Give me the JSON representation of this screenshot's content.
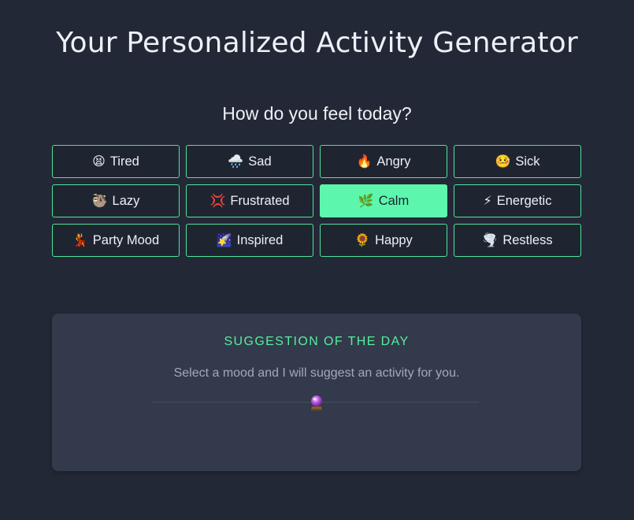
{
  "title": "Your Personalized Activity Generator",
  "question": "How do you feel today?",
  "moods": [
    {
      "emoji": "😫",
      "label": "Tired",
      "icon": "tired-face-icon",
      "selected": false
    },
    {
      "emoji": "🌧️",
      "label": "Sad",
      "icon": "rain-cloud-icon",
      "selected": false
    },
    {
      "emoji": "🔥",
      "label": "Angry",
      "icon": "fire-icon",
      "selected": false
    },
    {
      "emoji": "🤒",
      "label": "Sick",
      "icon": "sick-face-icon",
      "selected": false
    },
    {
      "emoji": "🦥",
      "label": "Lazy",
      "icon": "sloth-icon",
      "selected": false
    },
    {
      "emoji": "💢",
      "label": "Frustrated",
      "icon": "anger-symbol-icon",
      "selected": false
    },
    {
      "emoji": "🌿",
      "label": "Calm",
      "icon": "herb-icon",
      "selected": true
    },
    {
      "emoji": "⚡",
      "label": "Energetic",
      "icon": "lightning-icon",
      "selected": false
    },
    {
      "emoji": "💃",
      "label": "Party Mood",
      "icon": "dancer-icon",
      "selected": false
    },
    {
      "emoji": "🌠",
      "label": "Inspired",
      "icon": "shooting-star-icon",
      "selected": false
    },
    {
      "emoji": "🌻",
      "label": "Happy",
      "icon": "sunflower-icon",
      "selected": false
    },
    {
      "emoji": "🌪️",
      "label": "Restless",
      "icon": "tornado-icon",
      "selected": false
    }
  ],
  "suggestion": {
    "heading": "SUGGESTION OF THE DAY",
    "text": "Select a mood and I will suggest an activity for you.",
    "icon": "crystal-ball-icon"
  },
  "colors": {
    "background": "#232836",
    "accent": "#5cf7ad",
    "card": "#333a4b"
  }
}
